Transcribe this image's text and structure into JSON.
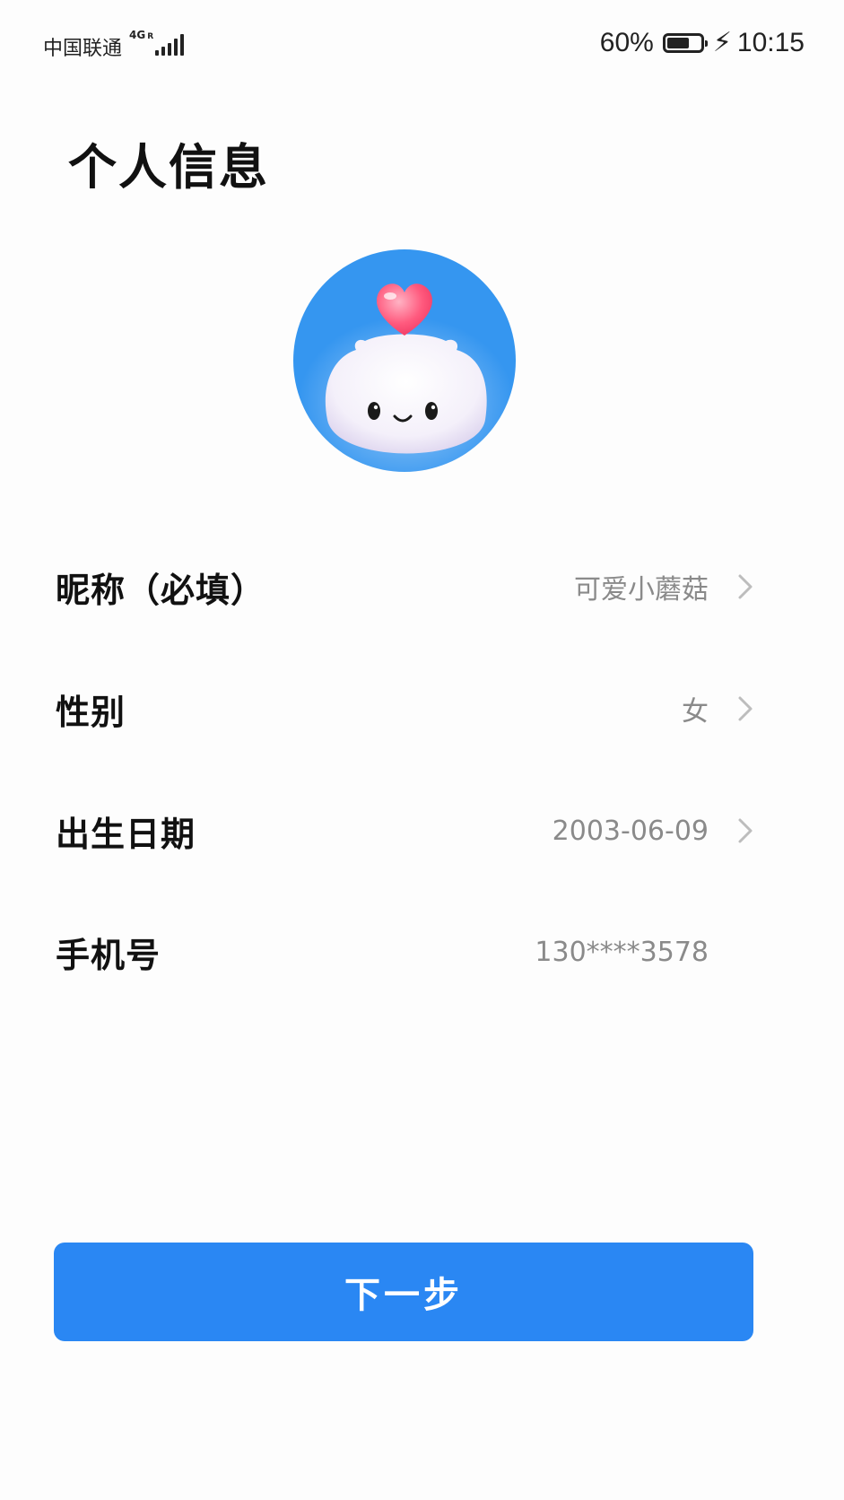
{
  "status_bar": {
    "carrier": "中国联通",
    "network_type": "4G",
    "roaming": "R",
    "battery_percent": "60%",
    "time": "10:15"
  },
  "page": {
    "title": "个人信息"
  },
  "avatar": {
    "description_icon": "avatar-mascot-with-heart"
  },
  "fields": [
    {
      "label": "昵称（必填）",
      "value": "可爱小蘑菇",
      "has_arrow": true
    },
    {
      "label": "性别",
      "value": "女",
      "has_arrow": true
    },
    {
      "label": "出生日期",
      "value": "2003-06-09",
      "has_arrow": true
    },
    {
      "label": "手机号",
      "value": "130****3578",
      "has_arrow": false
    }
  ],
  "actions": {
    "next_label": "下一步"
  },
  "colors": {
    "accent": "#2a87f3",
    "avatar_bg": "#3596f0",
    "value_text": "#8a8a8a"
  }
}
